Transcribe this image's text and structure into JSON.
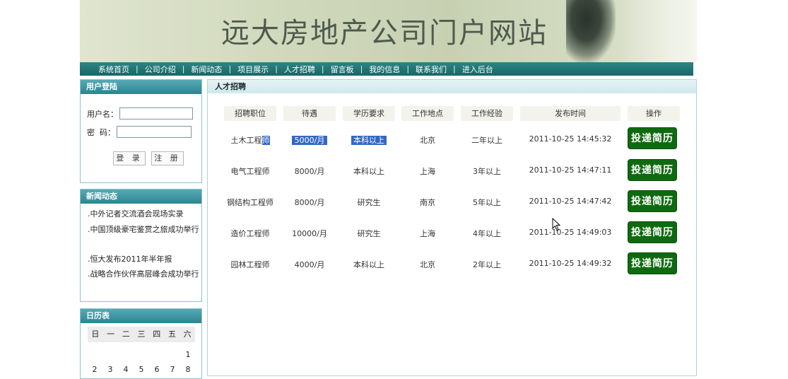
{
  "site_title": "远大房地产公司门户网站",
  "nav": [
    "系统首页",
    "公司介绍",
    "新闻动态",
    "项目展示",
    "人才招聘",
    "留言板",
    "我的信息",
    "联系我们",
    "进入后台"
  ],
  "nav_separator": "|",
  "login": {
    "title": "用户登陆",
    "username_label": "用户名：",
    "password_label": "密  码：",
    "username_value": "",
    "password_value": "",
    "login_button": "登 录",
    "register_button": "注 册"
  },
  "news": {
    "title": "新闻动态",
    "items": [
      ".中外记者交流酒会现场实录",
      ".中国顶级豪宅鉴赏之旅成功举行",
      ".恒大发布2011年半年报",
      ".战略合作伙伴高层峰会成功举行"
    ]
  },
  "calendar": {
    "title": "日历表",
    "weekdays": [
      "日",
      "一",
      "二",
      "三",
      "四",
      "五",
      "六"
    ],
    "row1": [
      "",
      "",
      "",
      "",
      "",
      "",
      "1"
    ],
    "row2": [
      "2",
      "3",
      "4",
      "5",
      "6",
      "7",
      "8"
    ]
  },
  "main": {
    "title": "人才招聘",
    "headers": [
      "招聘职位",
      "待遇",
      "学历要求",
      "工作地点",
      "工作经验",
      "发布时间",
      "操作"
    ],
    "apply_label": "投递简历",
    "rows": [
      {
        "position_a": "土木工程",
        "position_b": "师",
        "salary": "5000/月",
        "education": "本科以上",
        "location": "北京",
        "experience": "二年以上",
        "date": "2011-10-25 14:45:32"
      },
      {
        "position_a": "电气工程师",
        "position_b": "",
        "salary": "8000/月",
        "education": "本科以上",
        "location": "上海",
        "experience": "3年以上",
        "date": "2011-10-25 14:47:11"
      },
      {
        "position_a": "钢结构工程师",
        "position_b": "",
        "salary": "8000/月",
        "education": "研究生",
        "location": "南京",
        "experience": "5年以上",
        "date": "2011-10-25 14:47:42"
      },
      {
        "position_a": "造价工程师",
        "position_b": "",
        "salary": "10000/月",
        "education": "研究生",
        "location": "上海",
        "experience": "4年以上",
        "date": "2011-10-25 14:49:03"
      },
      {
        "position_a": "园林工程师",
        "position_b": "",
        "salary": "4000/月",
        "education": "本科以上",
        "location": "北京",
        "experience": "2年以上",
        "date": "2011-10-25 14:49:32"
      }
    ]
  },
  "colors": {
    "nav": "#1f6f6f",
    "panel_head": "#3a95a0",
    "apply_button": "#0f6a0f",
    "selection": "#3367c5"
  }
}
